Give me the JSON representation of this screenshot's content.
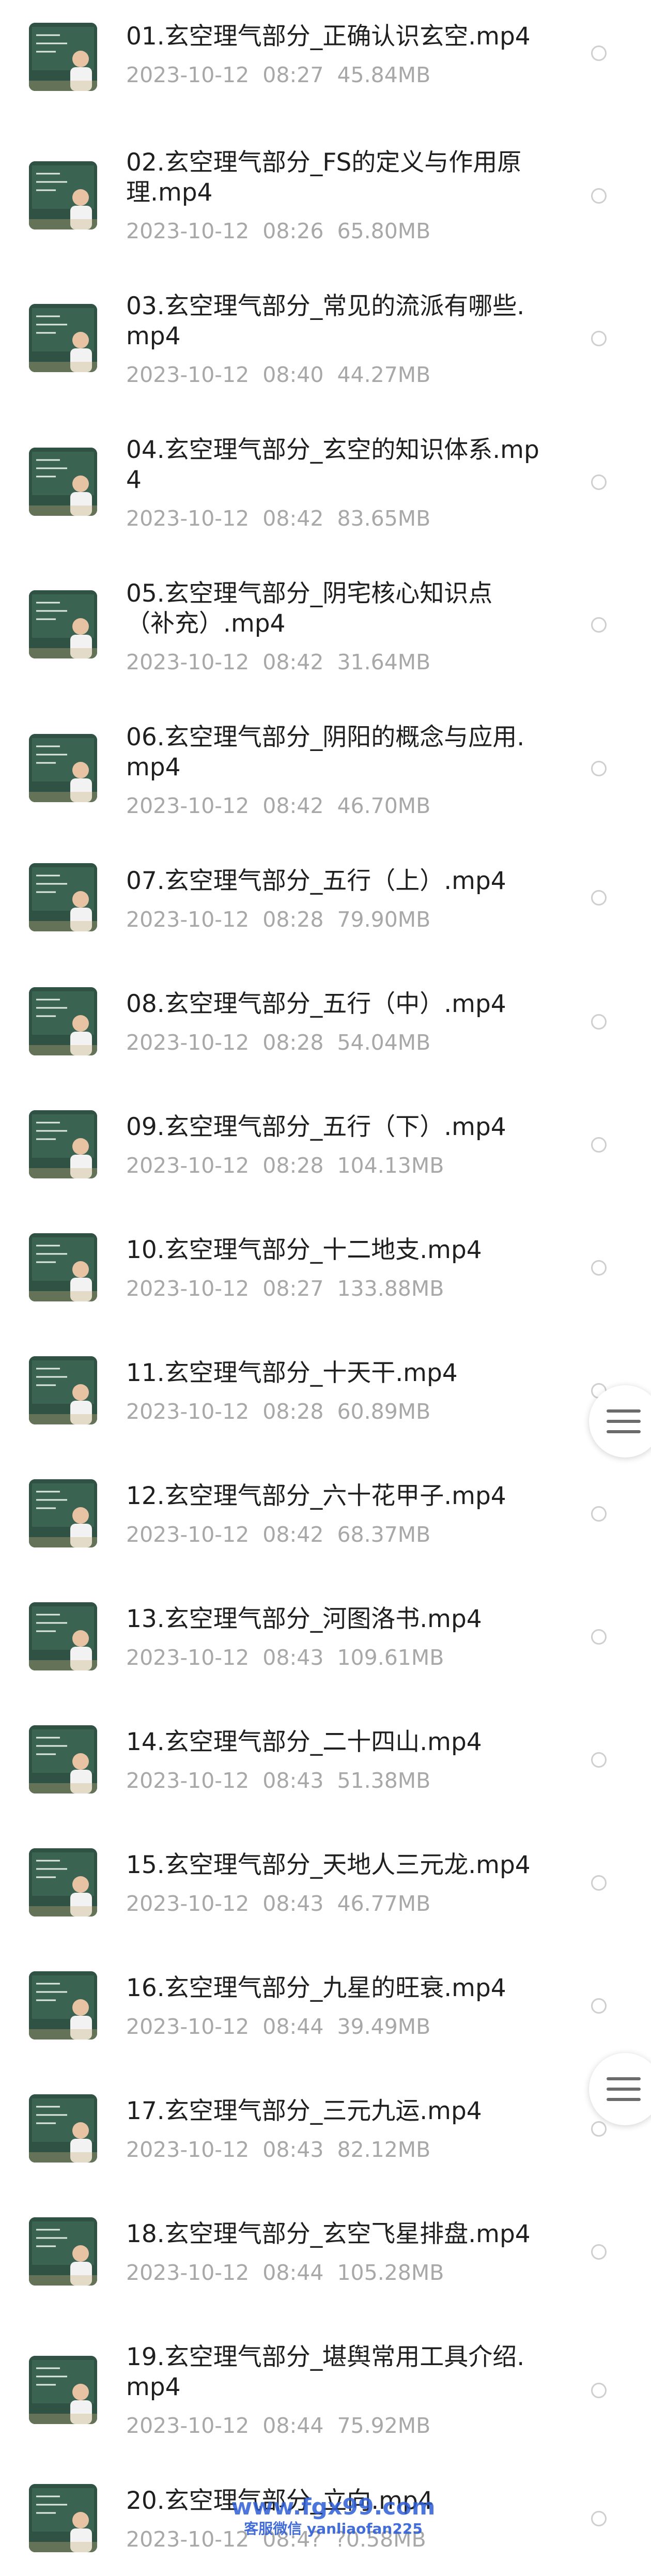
{
  "files": [
    {
      "name": "01.玄空理气部分_正确认识玄空.mp4",
      "date": "2023-10-12",
      "time": "08:27",
      "size": "45.84MB",
      "thumbnail_icon": "video-thumbnail"
    },
    {
      "name": "02.玄空理气部分_FS的定义与作用原理.mp4",
      "date": "2023-10-12",
      "time": "08:26",
      "size": "65.80MB",
      "thumbnail_icon": "video-thumbnail"
    },
    {
      "name": "03.玄空理气部分_常见的流派有哪些.mp4",
      "date": "2023-10-12",
      "time": "08:40",
      "size": "44.27MB",
      "thumbnail_icon": "video-thumbnail"
    },
    {
      "name": "04.玄空理气部分_玄空的知识体系.mp4",
      "date": "2023-10-12",
      "time": "08:42",
      "size": "83.65MB",
      "thumbnail_icon": "video-thumbnail"
    },
    {
      "name": "05.玄空理气部分_阴宅核心知识点（补充）.mp4",
      "date": "2023-10-12",
      "time": "08:42",
      "size": "31.64MB",
      "thumbnail_icon": "video-thumbnail"
    },
    {
      "name": "06.玄空理气部分_阴阳的概念与应用.mp4",
      "date": "2023-10-12",
      "time": "08:42",
      "size": "46.70MB",
      "thumbnail_icon": "video-thumbnail"
    },
    {
      "name": "07.玄空理气部分_五行（上）.mp4",
      "date": "2023-10-12",
      "time": "08:28",
      "size": "79.90MB",
      "thumbnail_icon": "video-thumbnail"
    },
    {
      "name": "08.玄空理气部分_五行（中）.mp4",
      "date": "2023-10-12",
      "time": "08:28",
      "size": "54.04MB",
      "thumbnail_icon": "video-thumbnail"
    },
    {
      "name": "09.玄空理气部分_五行（下）.mp4",
      "date": "2023-10-12",
      "time": "08:28",
      "size": "104.13MB",
      "thumbnail_icon": "video-thumbnail"
    },
    {
      "name": "10.玄空理气部分_十二地支.mp4",
      "date": "2023-10-12",
      "time": "08:27",
      "size": "133.88MB",
      "thumbnail_icon": "video-thumbnail"
    },
    {
      "name": "11.玄空理气部分_十天干.mp4",
      "date": "2023-10-12",
      "time": "08:28",
      "size": "60.89MB",
      "thumbnail_icon": "video-thumbnail"
    },
    {
      "name": "12.玄空理气部分_六十花甲子.mp4",
      "date": "2023-10-12",
      "time": "08:42",
      "size": "68.37MB",
      "thumbnail_icon": "video-thumbnail"
    },
    {
      "name": "13.玄空理气部分_河图洛书.mp4",
      "date": "2023-10-12",
      "time": "08:43",
      "size": "109.61MB",
      "thumbnail_icon": "video-thumbnail"
    },
    {
      "name": "14.玄空理气部分_二十四山.mp4",
      "date": "2023-10-12",
      "time": "08:43",
      "size": "51.38MB",
      "thumbnail_icon": "video-thumbnail"
    },
    {
      "name": "15.玄空理气部分_天地人三元龙.mp4",
      "date": "2023-10-12",
      "time": "08:43",
      "size": "46.77MB",
      "thumbnail_icon": "video-thumbnail"
    },
    {
      "name": "16.玄空理气部分_九星的旺衰.mp4",
      "date": "2023-10-12",
      "time": "08:44",
      "size": "39.49MB",
      "thumbnail_icon": "video-thumbnail"
    },
    {
      "name": "17.玄空理气部分_三元九运.mp4",
      "date": "2023-10-12",
      "time": "08:43",
      "size": "82.12MB",
      "thumbnail_icon": "video-thumbnail"
    },
    {
      "name": "18.玄空理气部分_玄空飞星排盘.mp4",
      "date": "2023-10-12",
      "time": "08:44",
      "size": "105.28MB",
      "thumbnail_icon": "video-thumbnail"
    },
    {
      "name": "19.玄空理气部分_堪舆常用工具介绍.mp4",
      "date": "2023-10-12",
      "time": "08:44",
      "size": "75.92MB",
      "thumbnail_icon": "video-thumbnail"
    },
    {
      "name": "20.玄空理气部分_立向.mp4",
      "date": "2023-10-12",
      "time": "08:4?",
      "size": "?0.58MB",
      "thumbnail_icon": "video-thumbnail"
    }
  ],
  "floating_buttons": [
    {
      "icon": "menu-icon"
    },
    {
      "icon": "menu-icon"
    }
  ],
  "watermark": {
    "line1": "www.fgx99.com",
    "line2": "客服微信 yanliaofan225"
  },
  "colors": {
    "title": "#1f1f1f",
    "meta": "#a8a8a8",
    "radio_border": "#cfcfcf",
    "watermark": "#2f5fd6",
    "thumbnail_bg": "#2c4a3c"
  }
}
